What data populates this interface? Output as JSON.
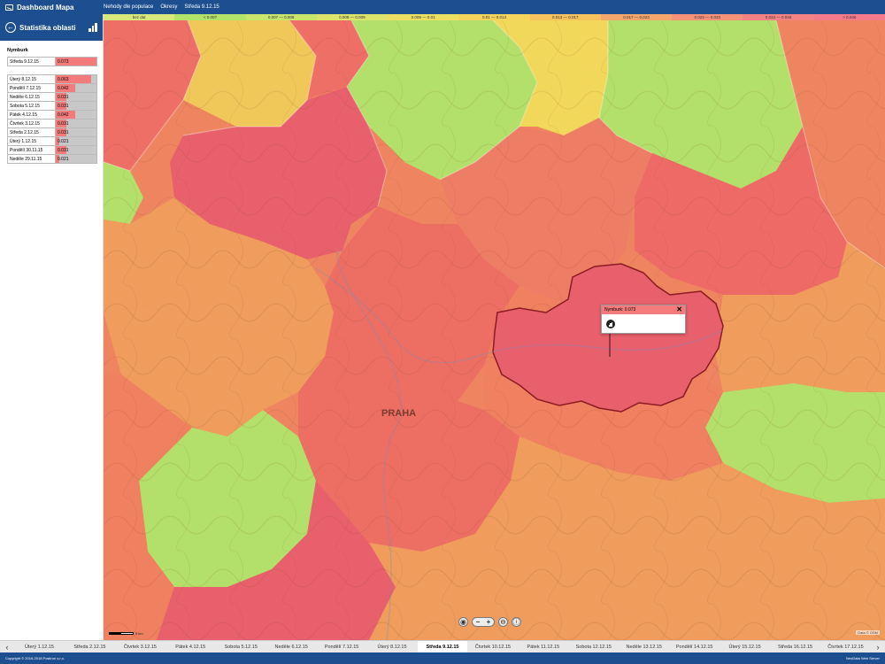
{
  "topbar": {
    "app_title": "Dashboard Mapa",
    "nav": [
      "Nehody dle populace",
      "Okresy",
      "Středa 9.12.15"
    ]
  },
  "legend": [
    {
      "label": "bez dat",
      "color": "#d9e87a"
    },
    {
      "label": "< 0.007",
      "color": "#b4e36a"
    },
    {
      "label": "0.007 — 0.008",
      "color": "#c9e56c"
    },
    {
      "label": "0.008 — 0.009",
      "color": "#dde46a"
    },
    {
      "label": "0.009 — 0.01",
      "color": "#eddf62"
    },
    {
      "label": "0.01 — 0.013",
      "color": "#f5d45b"
    },
    {
      "label": "0.013 — 0.017",
      "color": "#f7c15d"
    },
    {
      "label": "0.017 — 0.023",
      "color": "#f5a66a"
    },
    {
      "label": "0.023 — 0.033",
      "color": "#f59277"
    },
    {
      "label": "0.033 — 0.046",
      "color": "#f58283"
    },
    {
      "label": "> 0.046",
      "color": "#f57a8a"
    }
  ],
  "sidebar": {
    "title": "Statistika oblasti",
    "region": "Nymburk",
    "current": {
      "label": "Středa 9.12.15",
      "value": "0.073",
      "fraction": 1.0
    },
    "history": [
      {
        "label": "Úterý 8.12.15",
        "value": "0.063",
        "fraction": 0.86
      },
      {
        "label": "Pondělí 7.12.15",
        "value": "0.042",
        "fraction": 0.47
      },
      {
        "label": "Neděle 6.12.15",
        "value": "0.031",
        "fraction": 0.26
      },
      {
        "label": "Sobota 5.12.15",
        "value": "0.031",
        "fraction": 0.26
      },
      {
        "label": "Pátek 4.12.15",
        "value": "0.042",
        "fraction": 0.47
      },
      {
        "label": "Čtvrtek 3.12.15",
        "value": "0.031",
        "fraction": 0.26
      },
      {
        "label": "Středa 2.12.15",
        "value": "0.031",
        "fraction": 0.26
      },
      {
        "label": "Úterý 1.12.15",
        "value": "0.021",
        "fraction": 0.08
      },
      {
        "label": "Pondělí 30.11.15",
        "value": "0.031",
        "fraction": 0.26
      },
      {
        "label": "Neděle 29.11.15",
        "value": "0.021",
        "fraction": 0.08
      }
    ]
  },
  "map": {
    "city_label": "PRAHA",
    "popup_title": "Nymburk: 0.073",
    "scale_label": "5 km",
    "attribution": "Data © OSM"
  },
  "timeline": {
    "active_index": 8,
    "days": [
      "Úterý 1.12.15",
      "Středa 2.12.15",
      "Čtvrtek 3.12.15",
      "Pátek 4.12.15",
      "Sobota 5.12.15",
      "Neděle 6.12.15",
      "Pondělí 7.12.15",
      "Úterý 8.12.15",
      "Středa 9.12.15",
      "Čtvrtek 10.12.15",
      "Pátek 11.12.15",
      "Sobota 12.12.15",
      "Neděle 13.12.15",
      "Pondělí 14.12.15",
      "Úterý 15.12.15",
      "Středa 16.12.15",
      "Čtvrtek 17.12.15"
    ]
  },
  "footer": {
    "copyright": "Copyright © 2016-2018 Positron s.r.o.",
    "right": "NeoData Web Server"
  },
  "colors": {
    "red": "#ee6666",
    "salmon": "#ef8560",
    "orange": "#ef9c5c",
    "yellow": "#f2cf58",
    "green": "#b3e06a",
    "highlight": "#e5606a"
  }
}
